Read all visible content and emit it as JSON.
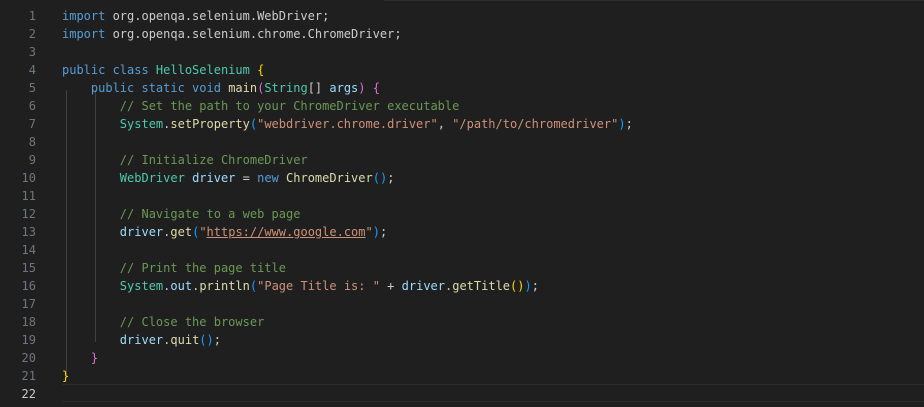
{
  "editor": {
    "active_line": 22,
    "lines": [
      {
        "n": "1",
        "tokens": [
          {
            "t": "import",
            "c": "kw"
          },
          {
            "t": " org.openqa.selenium.WebDriver;",
            "c": "pl"
          }
        ]
      },
      {
        "n": "2",
        "tokens": [
          {
            "t": "import",
            "c": "kw"
          },
          {
            "t": " org.openqa.selenium.chrome.ChromeDriver;",
            "c": "pl"
          }
        ]
      },
      {
        "n": "3",
        "tokens": []
      },
      {
        "n": "4",
        "tokens": [
          {
            "t": "public class ",
            "c": "kw"
          },
          {
            "t": "HelloSelenium",
            "c": "cls"
          },
          {
            "t": " ",
            "c": "pl"
          },
          {
            "t": "{",
            "c": "b1"
          }
        ]
      },
      {
        "n": "5",
        "tokens": [
          {
            "t": "    ",
            "c": "pl"
          },
          {
            "t": "public static void ",
            "c": "kw"
          },
          {
            "t": "main",
            "c": "fn"
          },
          {
            "t": "(",
            "c": "b2"
          },
          {
            "t": "String",
            "c": "cls"
          },
          {
            "t": "[] ",
            "c": "pl"
          },
          {
            "t": "args",
            "c": "var"
          },
          {
            "t": ")",
            "c": "b2"
          },
          {
            "t": " ",
            "c": "pl"
          },
          {
            "t": "{",
            "c": "b2"
          }
        ]
      },
      {
        "n": "6",
        "tokens": [
          {
            "t": "        ",
            "c": "pl"
          },
          {
            "t": "// Set the path to your ChromeDriver executable",
            "c": "cmt"
          }
        ]
      },
      {
        "n": "7",
        "tokens": [
          {
            "t": "        ",
            "c": "pl"
          },
          {
            "t": "System",
            "c": "cls"
          },
          {
            "t": ".",
            "c": "pl"
          },
          {
            "t": "setProperty",
            "c": "fn"
          },
          {
            "t": "(",
            "c": "b3"
          },
          {
            "t": "\"webdriver.chrome.driver\"",
            "c": "str"
          },
          {
            "t": ", ",
            "c": "pl"
          },
          {
            "t": "\"/path/to/chromedriver\"",
            "c": "str"
          },
          {
            "t": ")",
            "c": "b3"
          },
          {
            "t": ";",
            "c": "pl"
          }
        ]
      },
      {
        "n": "8",
        "tokens": []
      },
      {
        "n": "9",
        "tokens": [
          {
            "t": "        ",
            "c": "pl"
          },
          {
            "t": "// Initialize ChromeDriver",
            "c": "cmt"
          }
        ]
      },
      {
        "n": "10",
        "tokens": [
          {
            "t": "        ",
            "c": "pl"
          },
          {
            "t": "WebDriver",
            "c": "cls"
          },
          {
            "t": " ",
            "c": "pl"
          },
          {
            "t": "driver",
            "c": "var"
          },
          {
            "t": " = ",
            "c": "pl"
          },
          {
            "t": "new",
            "c": "kw"
          },
          {
            "t": " ",
            "c": "pl"
          },
          {
            "t": "ChromeDriver",
            "c": "fn"
          },
          {
            "t": "()",
            "c": "b3"
          },
          {
            "t": ";",
            "c": "pl"
          }
        ]
      },
      {
        "n": "11",
        "tokens": []
      },
      {
        "n": "12",
        "tokens": [
          {
            "t": "        ",
            "c": "pl"
          },
          {
            "t": "// Navigate to a web page",
            "c": "cmt"
          }
        ]
      },
      {
        "n": "13",
        "tokens": [
          {
            "t": "        ",
            "c": "pl"
          },
          {
            "t": "driver",
            "c": "var"
          },
          {
            "t": ".",
            "c": "pl"
          },
          {
            "t": "get",
            "c": "fn"
          },
          {
            "t": "(",
            "c": "b3"
          },
          {
            "t": "\"",
            "c": "str"
          },
          {
            "t": "https://www.google.com",
            "c": "str link"
          },
          {
            "t": "\"",
            "c": "str"
          },
          {
            "t": ")",
            "c": "b3"
          },
          {
            "t": ";",
            "c": "pl"
          }
        ]
      },
      {
        "n": "14",
        "tokens": []
      },
      {
        "n": "15",
        "tokens": [
          {
            "t": "        ",
            "c": "pl"
          },
          {
            "t": "// Print the page title",
            "c": "cmt"
          }
        ]
      },
      {
        "n": "16",
        "tokens": [
          {
            "t": "        ",
            "c": "pl"
          },
          {
            "t": "System",
            "c": "cls"
          },
          {
            "t": ".",
            "c": "pl"
          },
          {
            "t": "out",
            "c": "var"
          },
          {
            "t": ".",
            "c": "pl"
          },
          {
            "t": "println",
            "c": "fn"
          },
          {
            "t": "(",
            "c": "b3"
          },
          {
            "t": "\"Page Title is: \"",
            "c": "str"
          },
          {
            "t": " + ",
            "c": "pl"
          },
          {
            "t": "driver",
            "c": "var"
          },
          {
            "t": ".",
            "c": "pl"
          },
          {
            "t": "getTitle",
            "c": "fn"
          },
          {
            "t": "()",
            "c": "b1"
          },
          {
            "t": ")",
            "c": "b3"
          },
          {
            "t": ";",
            "c": "pl"
          }
        ]
      },
      {
        "n": "17",
        "tokens": []
      },
      {
        "n": "18",
        "tokens": [
          {
            "t": "        ",
            "c": "pl"
          },
          {
            "t": "// Close the browser",
            "c": "cmt"
          }
        ]
      },
      {
        "n": "19",
        "tokens": [
          {
            "t": "        ",
            "c": "pl"
          },
          {
            "t": "driver",
            "c": "var"
          },
          {
            "t": ".",
            "c": "pl"
          },
          {
            "t": "quit",
            "c": "fn"
          },
          {
            "t": "()",
            "c": "b3"
          },
          {
            "t": ";",
            "c": "pl"
          }
        ]
      },
      {
        "n": "20",
        "tokens": [
          {
            "t": "    ",
            "c": "pl"
          },
          {
            "t": "}",
            "c": "b2"
          }
        ]
      },
      {
        "n": "21",
        "tokens": [
          {
            "t": "}",
            "c": "b1"
          }
        ]
      },
      {
        "n": "22",
        "tokens": []
      }
    ]
  }
}
